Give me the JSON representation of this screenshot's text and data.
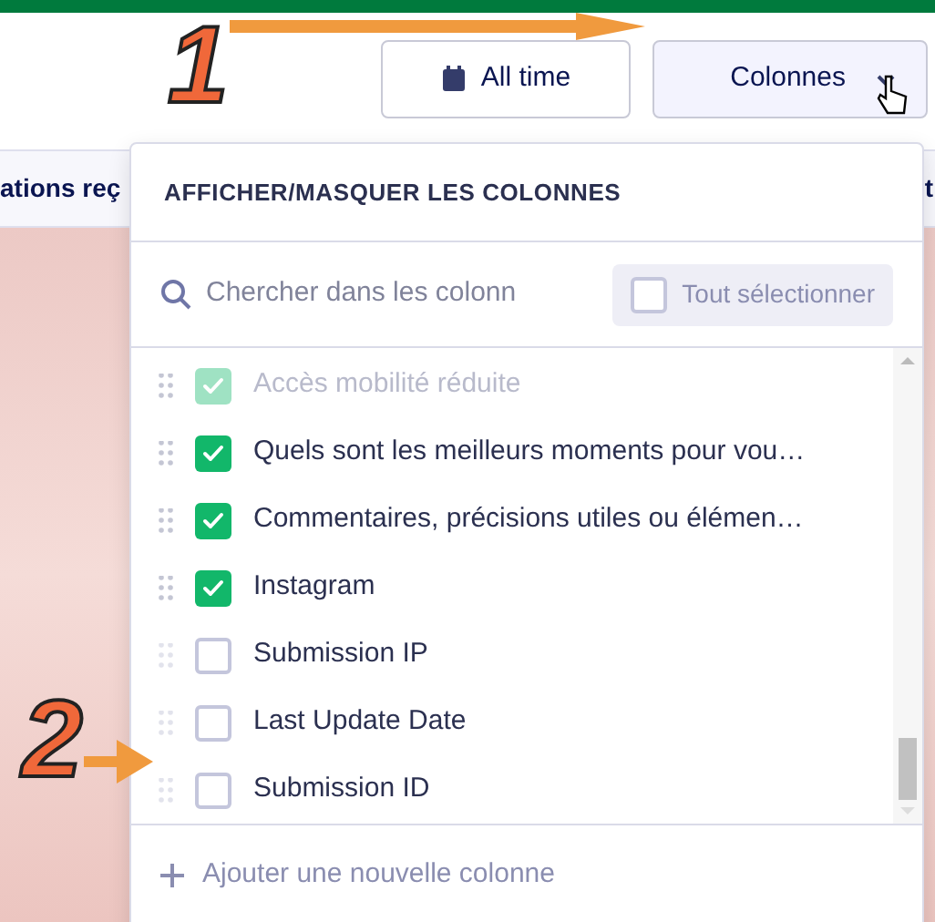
{
  "toolbar": {
    "buttons": [
      {
        "kind": "date",
        "label": "All time"
      },
      {
        "kind": "columns",
        "label": "Colonnes"
      }
    ]
  },
  "table": {
    "header_fragment": "ations reç",
    "column_fragment": "t"
  },
  "panel": {
    "title": "AFFICHER/MASQUER LES COLONNES",
    "search": {
      "placeholder": "Chercher dans les colonn"
    },
    "select_all": {
      "label": "Tout sélectionner",
      "checked": false
    },
    "columns": [
      {
        "label": "Accès mobilité réduite",
        "checked": true,
        "faded": true
      },
      {
        "label": "Quels sont les meilleurs moments pour vou…",
        "checked": true,
        "faded": false
      },
      {
        "label": "Commentaires, précisions utiles ou élémen…",
        "checked": true,
        "faded": false
      },
      {
        "label": "Instagram",
        "checked": true,
        "faded": false
      },
      {
        "label": "Submission IP",
        "checked": false,
        "faded": false
      },
      {
        "label": "Last Update Date",
        "checked": false,
        "faded": false
      },
      {
        "label": "Submission ID",
        "checked": false,
        "faded": false
      }
    ],
    "add_column": "Ajouter une nouvelle colonne"
  },
  "annotations": [
    {
      "label": "1"
    },
    {
      "label": "2"
    }
  ]
}
